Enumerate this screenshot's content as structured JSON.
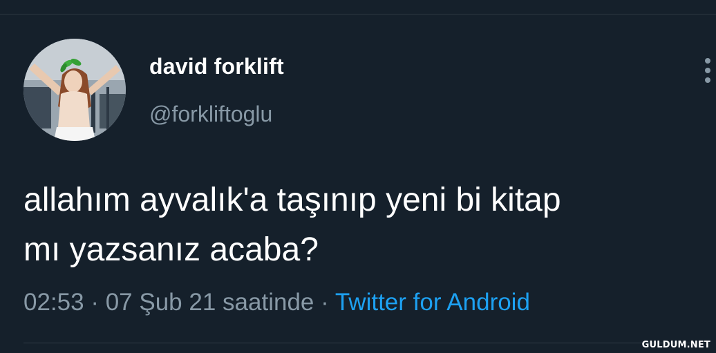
{
  "tweet": {
    "author": {
      "display_name": "david forklift",
      "handle": "@forkliftoglu",
      "avatar": "profile-photo"
    },
    "text_line_1": "allahım ayvalık'a taşınıp yeni bi kitap",
    "text_line_2": "mı yazsanız acaba?",
    "time": "02:53",
    "date": "07 Şub 21",
    "suffix": "saatinde",
    "separator": "·",
    "source": "Twitter for Android",
    "more_icon": "more-vertical-icon"
  },
  "watermark": "GULDUM.NET",
  "colors": {
    "background": "#15202b",
    "primary_text": "#ffffff",
    "secondary_text": "#8899a6",
    "link": "#1da1f2"
  }
}
